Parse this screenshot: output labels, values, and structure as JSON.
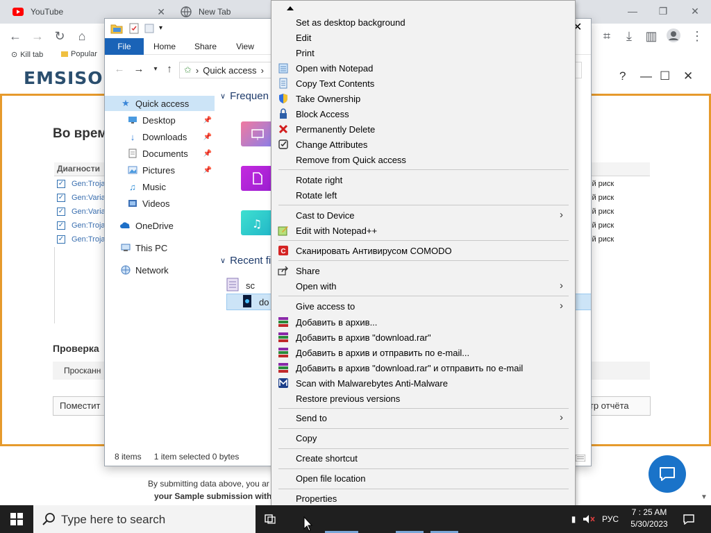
{
  "browser": {
    "tabs": [
      {
        "title": "YouTube"
      },
      {
        "title": "New Tab"
      }
    ],
    "bookmarks": [
      {
        "label": "Kill tab"
      },
      {
        "label": "Popular"
      }
    ]
  },
  "emsisoft": {
    "logo": "EMSISOFT",
    "heading": "Во врем",
    "diagnostics_header": "Диагности",
    "detections": [
      {
        "name": "Gen:Troja",
        "risk": "ій риск",
        "checked": true
      },
      {
        "name": "Gen:Varia",
        "risk": "ій риск",
        "checked": true
      },
      {
        "name": "Gen:Varia",
        "risk": "ій риск",
        "checked": true
      },
      {
        "name": "Gen:Troja",
        "risk": "ій риск",
        "checked": true
      },
      {
        "name": "Gen:Troja",
        "risk": "ій риск",
        "checked": true
      }
    ],
    "section_title": "Проверка",
    "scan_text": "Просканн",
    "button_left": "Поместит",
    "button_right": "мотр отчёта",
    "footer_line1": "By submitting data above, you ar",
    "footer_line2": "your Sample submission with"
  },
  "explorer": {
    "ribbon_tabs": [
      "File",
      "Home",
      "Share",
      "View"
    ],
    "address": "Quick access",
    "nav_items": [
      {
        "label": "Quick access",
        "pinned": false,
        "selected": true
      },
      {
        "label": "Desktop",
        "pinned": true
      },
      {
        "label": "Downloads",
        "pinned": true
      },
      {
        "label": "Documents",
        "pinned": true
      },
      {
        "label": "Pictures",
        "pinned": true
      },
      {
        "label": "Music",
        "pinned": false
      },
      {
        "label": "Videos",
        "pinned": false
      },
      {
        "label": "OneDrive",
        "pinned": false
      },
      {
        "label": "This PC",
        "pinned": false
      },
      {
        "label": "Network",
        "pinned": false
      }
    ],
    "frequent_header": "Frequen",
    "recent_header": "Recent fi",
    "recent_files": [
      {
        "name": "sc"
      },
      {
        "name": "do"
      }
    ],
    "status": {
      "items": "8 items",
      "selected": "1 item selected  0 bytes"
    }
  },
  "context_menu": {
    "items": [
      {
        "label": "Set as desktop background",
        "icon": "none"
      },
      {
        "label": "Edit",
        "icon": "none"
      },
      {
        "label": "Print",
        "icon": "none"
      },
      {
        "label": "Open with Notepad",
        "icon": "notepad-icon"
      },
      {
        "label": "Copy Text Contents",
        "icon": "copy-text-icon"
      },
      {
        "label": "Take Ownership",
        "icon": "shield-icon"
      },
      {
        "label": "Block Access",
        "icon": "lock-icon"
      },
      {
        "label": "Permanently Delete",
        "icon": "red-x-icon"
      },
      {
        "label": "Change Attributes",
        "icon": "checkbox-icon"
      },
      {
        "label": "Remove from Quick access",
        "icon": "none"
      },
      {
        "label": "Rotate right",
        "icon": "none"
      },
      {
        "label": "Rotate left",
        "icon": "none"
      },
      {
        "label": "Cast to Device",
        "icon": "none",
        "submenu": true
      },
      {
        "label": "Edit with Notepad++",
        "icon": "notepadpp-icon"
      },
      {
        "label": "Сканировать Антивирусом COMODO",
        "icon": "comodo-icon"
      },
      {
        "label": "Share",
        "icon": "share-icon"
      },
      {
        "label": "Open with",
        "icon": "none",
        "submenu": true
      },
      {
        "label": "Give access to",
        "icon": "none",
        "submenu": true
      },
      {
        "label": "Добавить в архив...",
        "icon": "winrar-icon"
      },
      {
        "label": "Добавить в архив \"download.rar\"",
        "icon": "winrar-icon"
      },
      {
        "label": "Добавить в архив и отправить по e-mail...",
        "icon": "winrar-icon"
      },
      {
        "label": "Добавить в архив \"download.rar\" и отправить по e-mail",
        "icon": "winrar-icon"
      },
      {
        "label": "Scan with Malwarebytes Anti-Malware",
        "icon": "malwarebytes-icon"
      },
      {
        "label": "Restore previous versions",
        "icon": "none"
      },
      {
        "label": "Send to",
        "icon": "none",
        "submenu": true
      },
      {
        "label": "Copy",
        "icon": "none"
      },
      {
        "label": "Create shortcut",
        "icon": "none"
      },
      {
        "label": "Open file location",
        "icon": "none"
      },
      {
        "label": "Properties",
        "icon": "none"
      }
    ]
  },
  "taskbar": {
    "search_placeholder": "Type here to search",
    "language": "РУС",
    "time": "7 : 25 AM",
    "date": "5/30/2023"
  },
  "colors": {
    "emsisoft_accent": "#e69a2c",
    "explorer_file_tab": "#1a63b7",
    "chat_button": "#1a73c9"
  }
}
